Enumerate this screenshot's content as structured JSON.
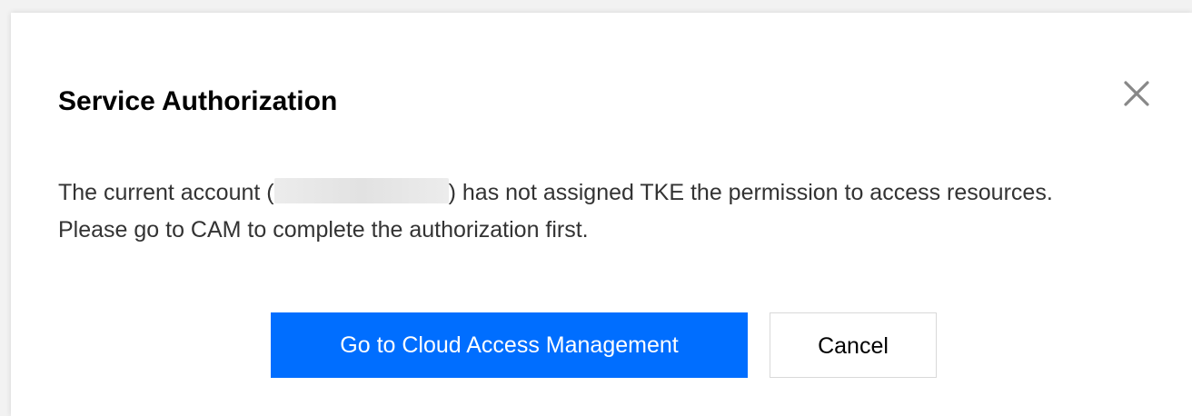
{
  "dialog": {
    "title": "Service Authorization",
    "close_icon": "close-icon",
    "message": {
      "line1_prefix": "The current account (",
      "account_id": "",
      "line1_suffix": ") has not assigned TKE the permission to access resources.",
      "line2": "Please go to CAM to complete the authorization first."
    },
    "primary_button_label": "Go to Cloud Access Management",
    "cancel_button_label": "Cancel"
  },
  "colors": {
    "primary": "#006eff",
    "text": "#333333",
    "title": "#000000",
    "border": "#d9d9d9"
  }
}
